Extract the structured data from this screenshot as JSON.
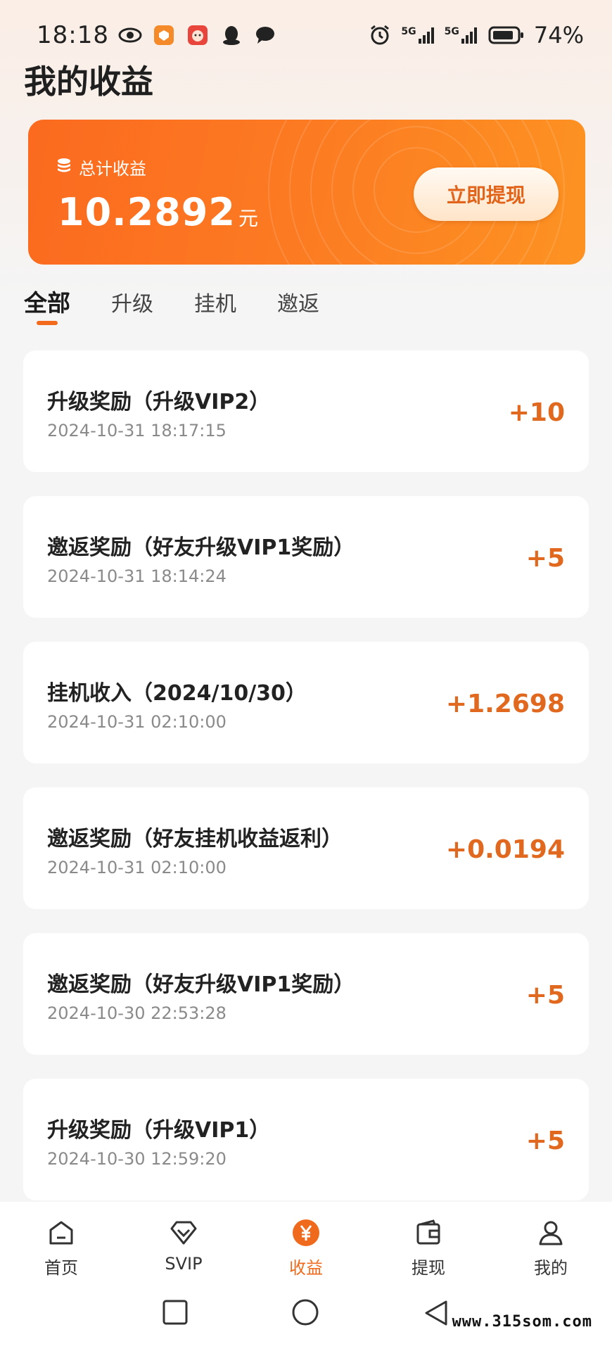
{
  "status_bar": {
    "time": "18:18",
    "network_1": "5G",
    "network_2": "5G",
    "battery": "74%"
  },
  "page": {
    "title": "我的收益"
  },
  "earnings_card": {
    "label": "总计收益",
    "amount": "10.2892",
    "unit": "元",
    "withdraw_label": "立即提现"
  },
  "tabs": [
    {
      "label": "全部",
      "active": true
    },
    {
      "label": "升级",
      "active": false
    },
    {
      "label": "挂机",
      "active": false
    },
    {
      "label": "邀返",
      "active": false
    }
  ],
  "records": [
    {
      "title": "升级奖励（升级VIP2）",
      "time": "2024-10-31 18:17:15",
      "amount": "+10"
    },
    {
      "title": "邀返奖励（好友升级VIP1奖励）",
      "time": "2024-10-31 18:14:24",
      "amount": "+5"
    },
    {
      "title": "挂机收入（2024/10/30）",
      "time": "2024-10-31 02:10:00",
      "amount": "+1.2698"
    },
    {
      "title": "邀返奖励（好友挂机收益返利）",
      "time": "2024-10-31 02:10:00",
      "amount": "+0.0194"
    },
    {
      "title": "邀返奖励（好友升级VIP1奖励）",
      "time": "2024-10-30 22:53:28",
      "amount": "+5"
    },
    {
      "title": "升级奖励（升级VIP1）",
      "time": "2024-10-30 12:59:20",
      "amount": "+5"
    }
  ],
  "bottom_nav": [
    {
      "label": "首页",
      "icon": "home-icon",
      "active": false
    },
    {
      "label": "SVIP",
      "icon": "diamond-icon",
      "active": false
    },
    {
      "label": "收益",
      "icon": "yen-coin-icon",
      "active": true
    },
    {
      "label": "提现",
      "icon": "wallet-icon",
      "active": false
    },
    {
      "label": "我的",
      "icon": "profile-icon",
      "active": false
    }
  ],
  "watermark": "www.315som.com",
  "colors": {
    "accent": "#ef6a1c",
    "amount": "#e0691f",
    "card_start": "#fb6a1f",
    "card_end": "#fd9322"
  }
}
